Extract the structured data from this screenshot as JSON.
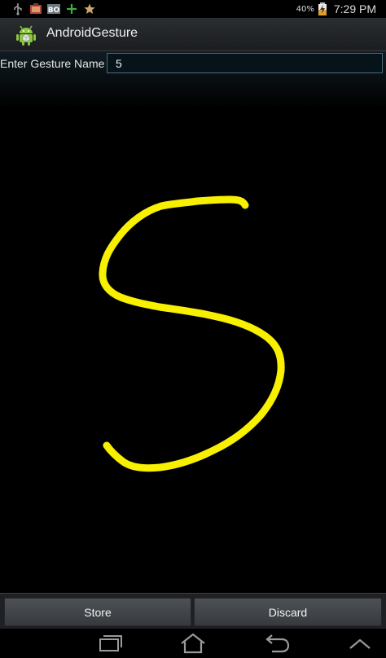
{
  "status_bar": {
    "battery_percent": "40%",
    "time": "7:29 PM",
    "left_icons": [
      "usb-icon",
      "gallery-icon",
      "bo-notification-icon",
      "plus-icon",
      "star-icon"
    ],
    "bo_text": "BO"
  },
  "action_bar": {
    "title": "AndroidGesture",
    "icon": "android-app-icon"
  },
  "form": {
    "label": "Enter Gesture Name",
    "value": "5"
  },
  "gesture": {
    "stroke_color": "#f7f000",
    "shape": "S"
  },
  "buttons": {
    "store": "Store",
    "discard": "Discard"
  },
  "navigation": {
    "items": [
      "recent-apps-icon",
      "home-icon",
      "back-icon",
      "menu-up-icon"
    ]
  },
  "colors": {
    "background": "#000000",
    "input_border": "#4c6a78",
    "action_bar": "#2a2d31"
  }
}
